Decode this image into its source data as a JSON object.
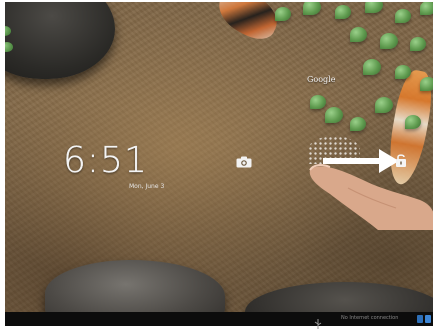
{
  "lockscreen": {
    "time": "6:51",
    "date": "Mon, June 3",
    "brand": "Google",
    "camera_icon": "camera-icon",
    "unlock_icon": "unlock-padlock-icon"
  },
  "status_bar": {
    "connection_text": "No Internet connection",
    "usb_icon": "usb-icon"
  },
  "colors": {
    "sand": "#7e6546",
    "status_bar": "#0c0c0c",
    "clock_text": "#f4f4f4"
  }
}
